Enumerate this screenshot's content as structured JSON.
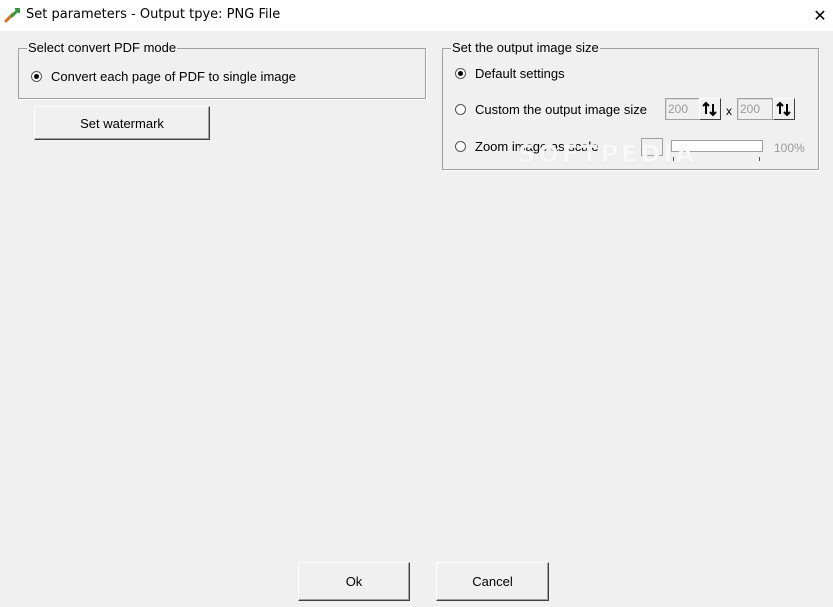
{
  "window": {
    "title": "Set parameters - Output tpye: PNG File",
    "close_glyph": "✕"
  },
  "convert_mode": {
    "label": "Select convert PDF mode",
    "option": "Convert each page of PDF to single image",
    "option_selected": true
  },
  "watermark_button": "Set watermark",
  "output_size": {
    "label": "Set the output image size",
    "options": [
      {
        "label": "Default settings",
        "selected": true
      },
      {
        "label": "Custom the output image size",
        "selected": false
      },
      {
        "label": "Zoom image as scale",
        "selected": false
      }
    ],
    "width_value": "200",
    "height_value": "200",
    "times_sign": "x",
    "zoom_percent": "100%"
  },
  "footer": {
    "ok_label": "Ok",
    "cancel_label": "Cancel"
  },
  "watermark_overlay": "SOFTPEDIA",
  "icons": {
    "app": "pdf-convert-arrows-icon",
    "close": "close-icon",
    "spin": "spin-arrows-icon"
  }
}
